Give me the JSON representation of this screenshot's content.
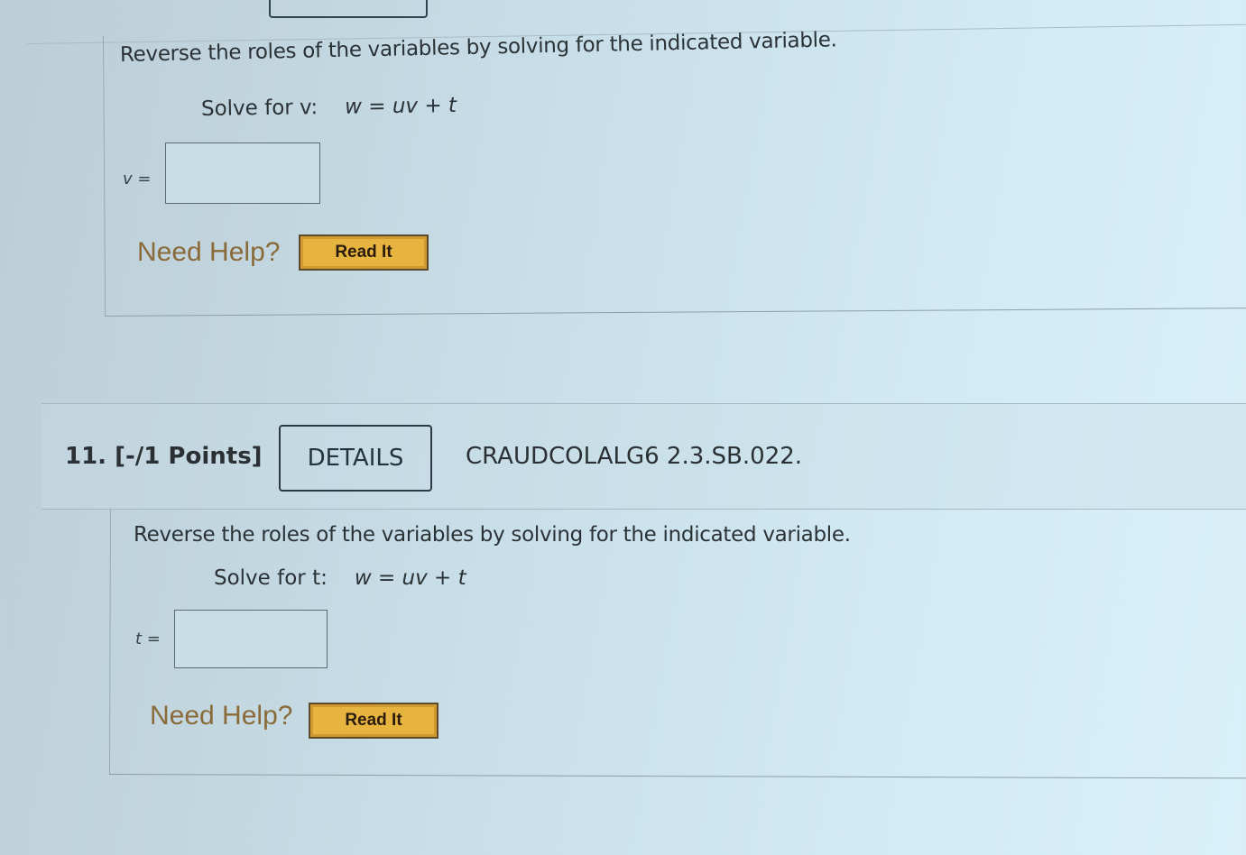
{
  "question10": {
    "prompt": "Reverse the roles of the variables by solving for the indicated variable.",
    "solve_label": "Solve for v:",
    "equation": "w = uv + t",
    "answer_label": "v =",
    "answer_value": "",
    "need_help_label": "Need Help?",
    "read_it_label": "Read It"
  },
  "question11": {
    "number_label": "11.  [-/1 Points]",
    "details_label": "DETAILS",
    "code": "CRAUDCOLALG6 2.3.SB.022.",
    "prompt": "Reverse the roles of the variables by solving for the indicated variable.",
    "solve_label": "Solve for t:",
    "equation": "w = uv + t",
    "answer_label": "t =",
    "answer_value": "",
    "need_help_label": "Need Help?",
    "read_it_label": "Read It"
  },
  "colors": {
    "read_it_bg": "#e8b440",
    "need_help_text": "#8a6a38",
    "details_border": "#2c3b43"
  }
}
